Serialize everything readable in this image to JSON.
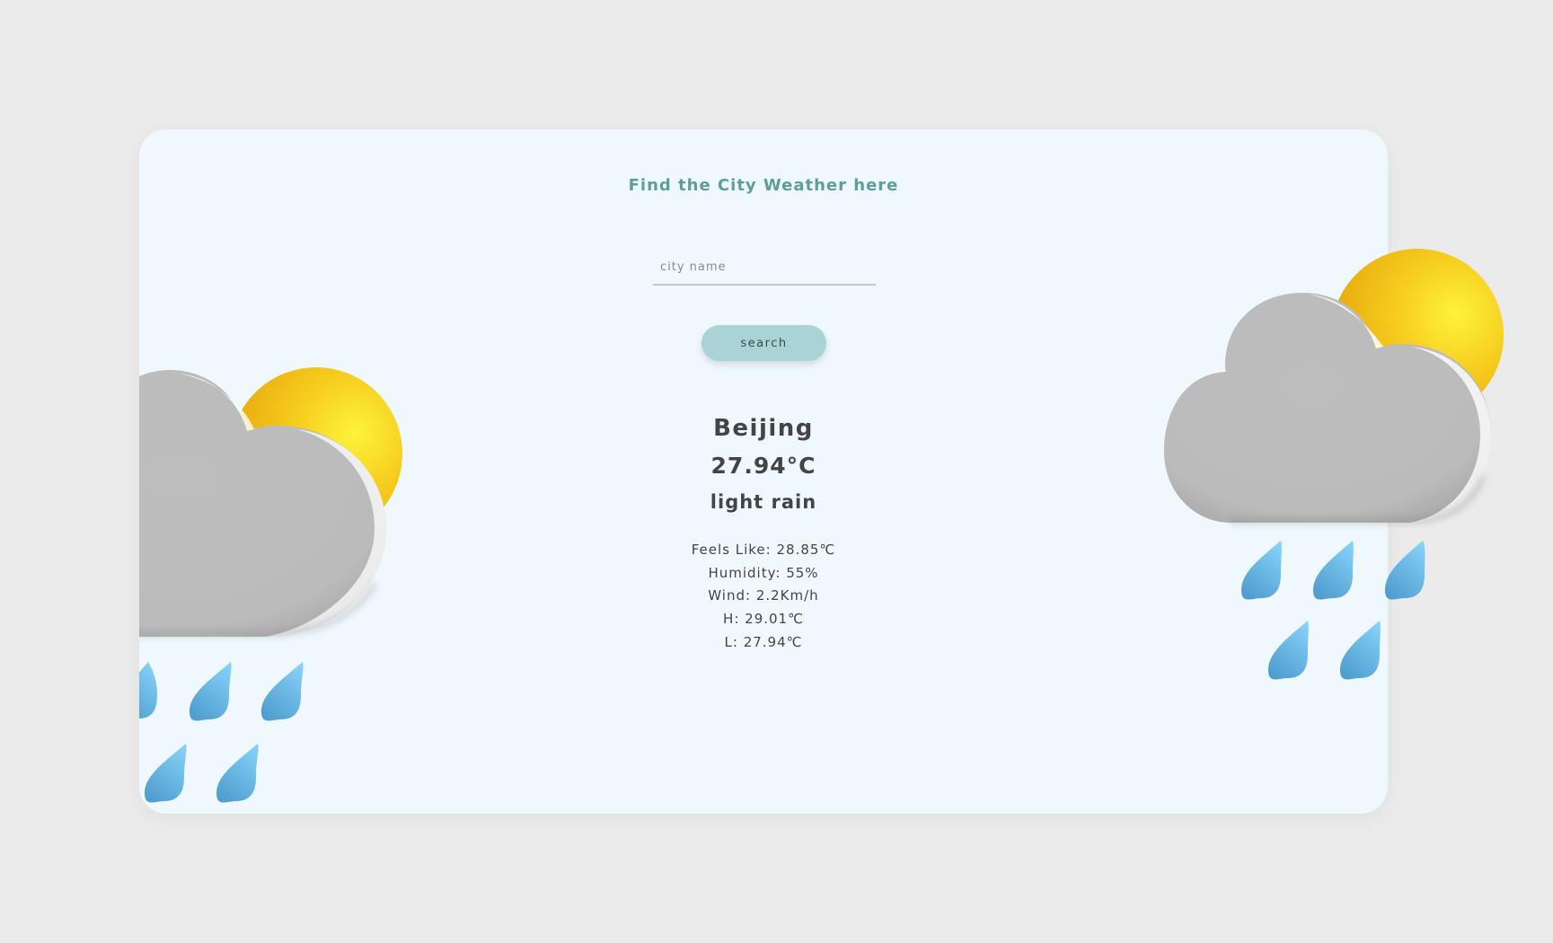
{
  "header": {
    "title": "Find the City Weather here"
  },
  "search": {
    "placeholder": "city name",
    "value": "",
    "button_label": "search"
  },
  "weather": {
    "city": "Beijing",
    "temperature": "27.94°C",
    "description": "light rain",
    "feels_like": "Feels Like: 28.85℃",
    "humidity": "Humidity: 55%",
    "wind": "Wind: 2.2Km/h",
    "high": "H: 29.01℃",
    "low": "L: 27.94℃"
  },
  "icons": {
    "left": "sun-cloud-rain-icon",
    "right": "sun-cloud-rain-icon"
  },
  "colors": {
    "page_background": "#ebebeb",
    "card_background": "#eff8fd",
    "heading": "#5f9c9c",
    "button": "#a9d3d4",
    "text": "#444444"
  }
}
